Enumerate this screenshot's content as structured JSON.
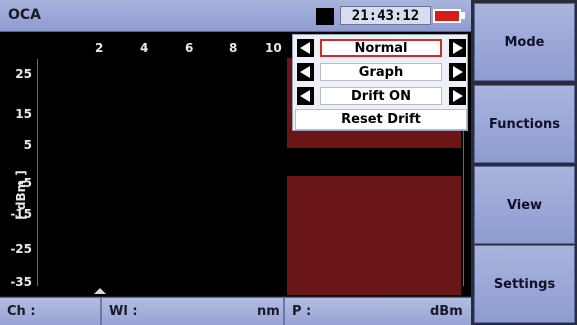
{
  "title_bar": {
    "app_title": "OCA",
    "clock": "21:43:12",
    "battery_color": "#d51d1d"
  },
  "plot": {
    "x_tick_labels": [
      "2",
      "4",
      "6",
      "8",
      "10"
    ],
    "y_tick_labels": [
      "25",
      "15",
      "5",
      "-5",
      "-15",
      "-25",
      "-35"
    ],
    "y_axis_label": "[ dBm ]",
    "bar_color": "#6b1616"
  },
  "popup_menu": {
    "options": [
      {
        "value": "Normal",
        "selected": true
      },
      {
        "value": "Graph",
        "selected": false
      },
      {
        "value": "Drift ON",
        "selected": false
      }
    ],
    "reset_label": "Reset Drift"
  },
  "footer": {
    "ch_label": "Ch :",
    "wl_label": "Wl :",
    "wl_unit": "nm",
    "p_label": "P :",
    "p_unit": "dBm"
  },
  "soft_keys": [
    {
      "label": "Mode"
    },
    {
      "label": "Functions"
    },
    {
      "label": "View"
    },
    {
      "label": "Settings"
    }
  ],
  "icons": {
    "left_arrow": "left-triangle",
    "right_arrow": "right-triangle",
    "marker": "up-triangle"
  }
}
